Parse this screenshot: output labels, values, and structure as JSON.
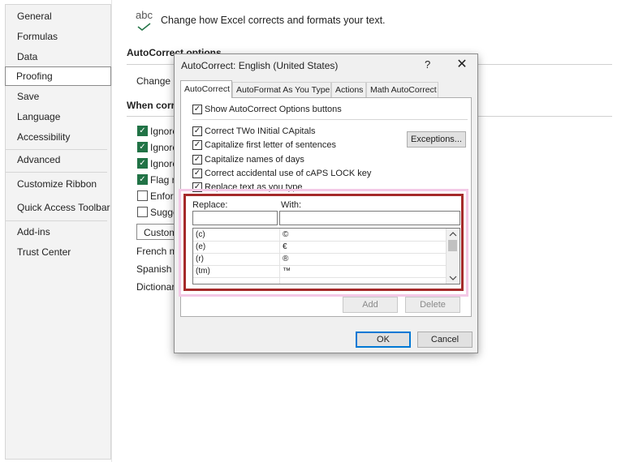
{
  "nav": {
    "items": [
      "General",
      "Formulas",
      "Data",
      "Proofing",
      "Save",
      "Language",
      "Accessibility",
      "Advanced",
      "Customize Ribbon",
      "Quick Access Toolbar",
      "Add-ins",
      "Trust Center"
    ],
    "selected": "Proofing"
  },
  "proofing": {
    "icon_text": "abc",
    "heading": "Change how Excel corrects and formats your text.",
    "autocorrect_section": "AutoCorrect options",
    "change_how": "Change h",
    "when_correcting": "When corre",
    "options": [
      "Ignore",
      "Ignore",
      "Ignore",
      "Flag re",
      "Enforc",
      "Sugge"
    ],
    "custom_button": "Custom",
    "french": "French m",
    "spanish": "Spanish m",
    "dictionary": "Dictionar"
  },
  "dialog": {
    "title": "AutoCorrect: English (United States)",
    "help": "?",
    "close": "✕",
    "tabs": [
      "AutoCorrect",
      "AutoFormat As You Type",
      "Actions",
      "Math AutoCorrect"
    ],
    "show_options": "Show AutoCorrect Options buttons",
    "checks": [
      "Correct TWo INitial CApitals",
      "Capitalize first letter of sentences",
      "Capitalize names of days",
      "Correct accidental use of cAPS LOCK key",
      "Replace text as you type"
    ],
    "exceptions_button": "Exceptions...",
    "replace_label": "Replace:",
    "with_label": "With:",
    "rows": [
      {
        "replace": "(c)",
        "with": "©"
      },
      {
        "replace": "(e)",
        "with": "€"
      },
      {
        "replace": "(r)",
        "with": "®"
      },
      {
        "replace": "(tm)",
        "with": "™"
      },
      {
        "replace": "...",
        "with": "…"
      }
    ],
    "add_button": "Add",
    "delete_button": "Delete",
    "ok_button": "OK",
    "cancel_button": "Cancel"
  },
  "colors": {
    "highlight": "#a52a2a",
    "accent": "#217346",
    "ok_border": "#0078d4"
  }
}
